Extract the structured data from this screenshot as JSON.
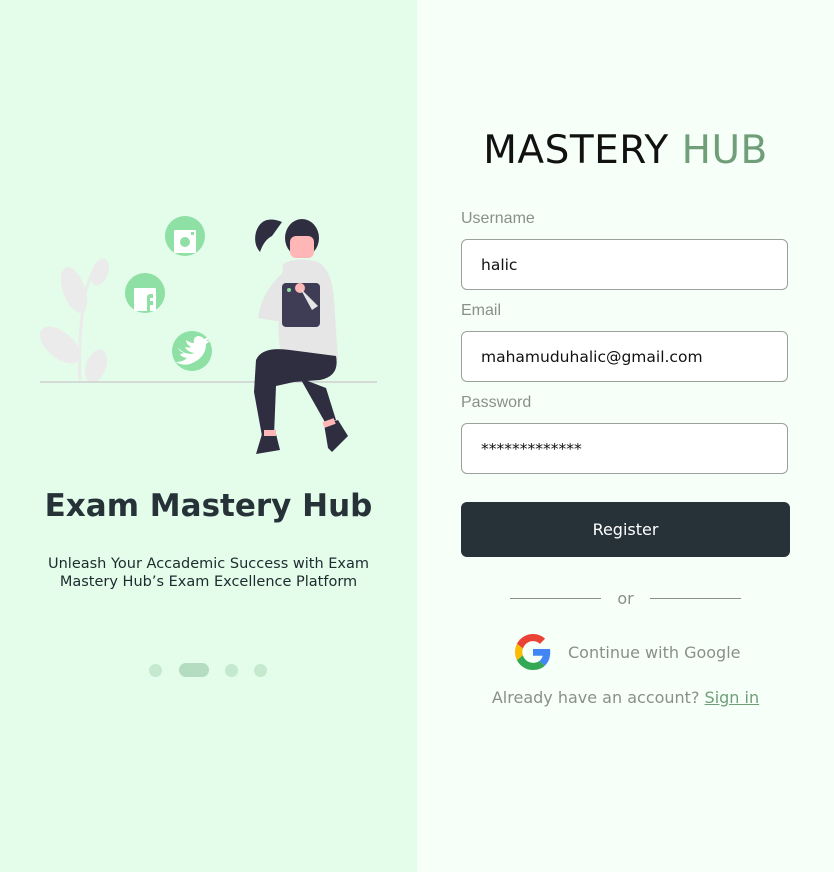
{
  "left_panel": {
    "title": "Exam Mastery Hub",
    "subtitle": "Unleash Your Accademic Success with Exam Mastery Hub’s Exam Excellence Platform",
    "carousel": {
      "count": 4,
      "active_index": 1
    }
  },
  "brand": {
    "part1": "MASTERY",
    "part2": "HUB"
  },
  "form": {
    "username": {
      "label": "Username",
      "value": "halic"
    },
    "email": {
      "label": "Email",
      "value": "mahamuduhalic@gmail.com"
    },
    "password": {
      "label": "Password",
      "value": "*************"
    },
    "register_label": "Register"
  },
  "divider_text": "or",
  "google": {
    "label": "Continue with Google",
    "icon": "google-icon"
  },
  "signin": {
    "prompt": "Already have an account?",
    "link": "Sign in"
  },
  "colors": {
    "left_bg": "#e3fdea",
    "right_bg": "#f7fff9",
    "accent_green": "#6f9e78",
    "dark": "#263238",
    "social_green": "#8fe0a4"
  },
  "illustration_icons": [
    "instagram-icon",
    "facebook-icon",
    "twitter-icon"
  ]
}
